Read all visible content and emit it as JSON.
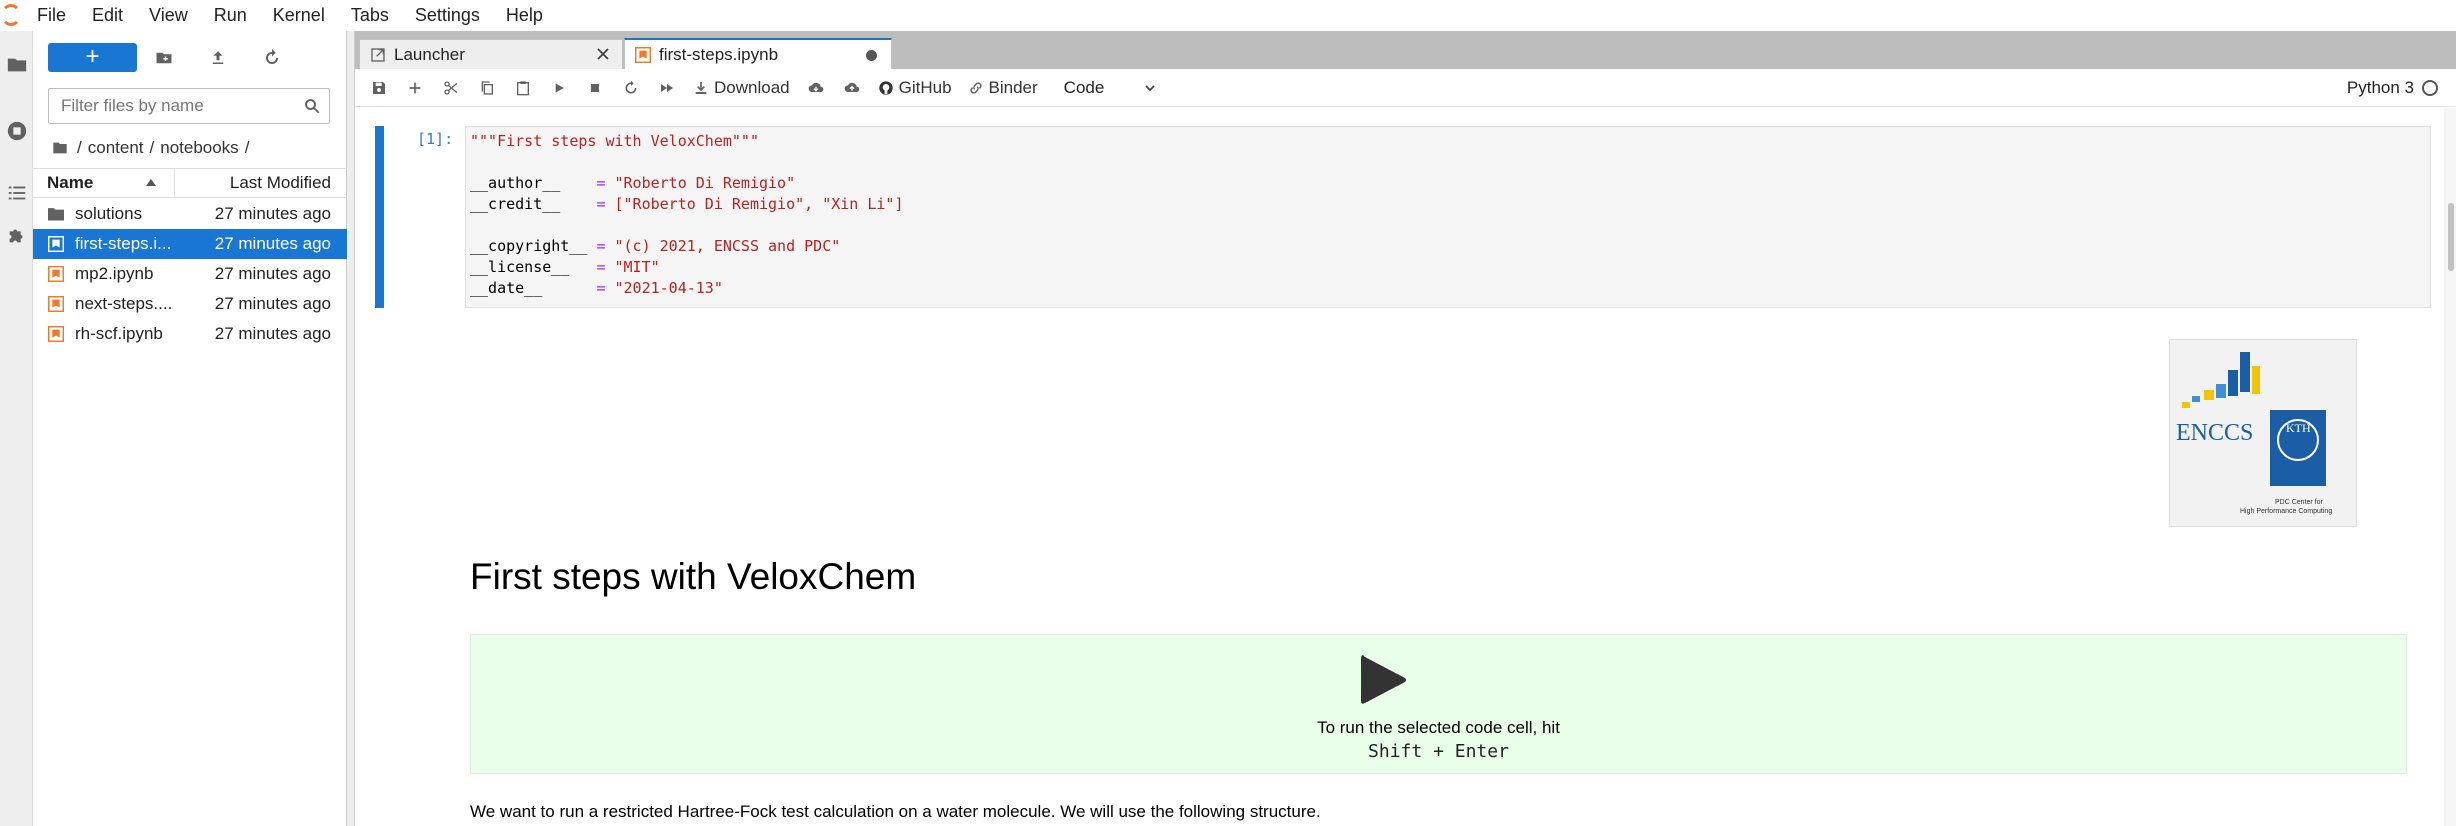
{
  "menubar": {
    "items": [
      "File",
      "Edit",
      "View",
      "Run",
      "Kernel",
      "Tabs",
      "Settings",
      "Help"
    ]
  },
  "filebrowser": {
    "new_label": "+",
    "filter_placeholder": "Filter files by name",
    "breadcrumb": [
      "/",
      "content",
      "/",
      "notebooks",
      "/"
    ],
    "col_name": "Name",
    "col_modified": "Last Modified",
    "files": [
      {
        "name": "solutions",
        "modified": "27 minutes ago",
        "type": "folder",
        "selected": false
      },
      {
        "name": "first-steps.ipynb",
        "display": "first-steps.i...",
        "modified": "27 minutes ago",
        "type": "notebook",
        "selected": true
      },
      {
        "name": "mp2.ipynb",
        "display": "mp2.ipynb",
        "modified": "27 minutes ago",
        "type": "notebook",
        "selected": false
      },
      {
        "name": "next-steps.ipynb",
        "display": "next-steps....",
        "modified": "27 minutes ago",
        "type": "notebook",
        "selected": false
      },
      {
        "name": "rh-scf.ipynb",
        "display": "rh-scf.ipynb",
        "modified": "27 minutes ago",
        "type": "notebook",
        "selected": false
      }
    ]
  },
  "tabs": [
    {
      "label": "Launcher",
      "active": false
    },
    {
      "label": "first-steps.ipynb",
      "active": true
    }
  ],
  "toolbar": {
    "download_label": "Download",
    "github_label": "GitHub",
    "binder_label": "Binder",
    "cell_type": "Code",
    "kernel_name": "Python 3"
  },
  "cell": {
    "prompt": "[1]:",
    "lines": [
      {
        "id": "\"\"\"First steps with VeloxChem\"\"\"",
        "op": "",
        "val": ""
      },
      {
        "id": "",
        "op": "",
        "val": ""
      },
      {
        "id": "__author__    ",
        "op": "= ",
        "val": "\"Roberto Di Remigio\""
      },
      {
        "id": "__credit__    ",
        "op": "= ",
        "val": "[\"Roberto Di Remigio\", \"Xin Li\"]"
      },
      {
        "id": "",
        "op": "",
        "val": ""
      },
      {
        "id": "__copyright__ ",
        "op": "= ",
        "val": "\"(c) 2021, ENCSS and PDC\""
      },
      {
        "id": "__license__   ",
        "op": "= ",
        "val": "\"MIT\""
      },
      {
        "id": "__date__      ",
        "op": "= ",
        "val": "\"2021-04-13\""
      }
    ]
  },
  "markdown": {
    "heading": "First steps with VeloxChem",
    "callout_line1": "To run the selected code cell, hit",
    "callout_line2": "Shift + Enter",
    "paragraph": "We want to run a restricted Hartree-Fock test calculation on a water molecule. We will use the following structure.",
    "logo_text_encss": "ENCCS",
    "logo_text_kth": "KTH",
    "logo_caption_1": "PDC Center for",
    "logo_caption_2": "High Performance Computing"
  },
  "colors": {
    "accent": "#1976d2",
    "notebook_icon": "#f37726",
    "callout_bg": "#eaffea",
    "string": "#ba2121",
    "operator": "#aa22ff"
  }
}
